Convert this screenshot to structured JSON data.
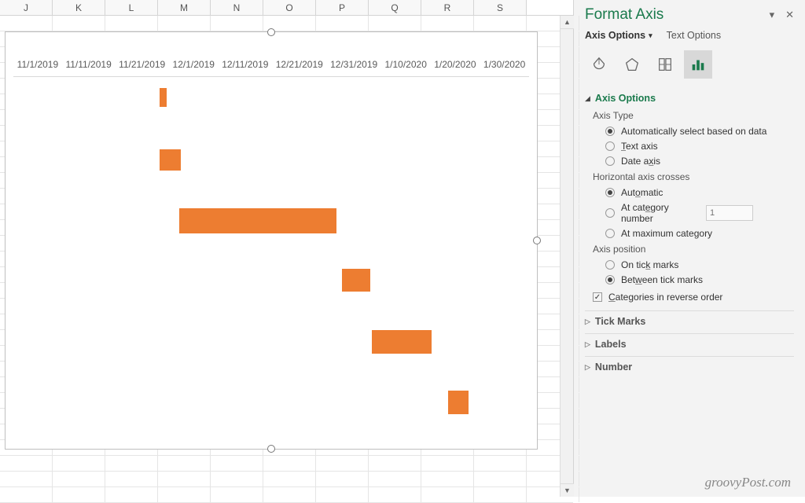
{
  "columns": [
    "J",
    "K",
    "L",
    "M",
    "N",
    "O",
    "P",
    "Q",
    "R",
    "S"
  ],
  "chart_data": {
    "type": "bar",
    "orientation": "horizontal",
    "x_axis_labels": [
      "11/1/2019",
      "11/11/2019",
      "11/21/2019",
      "12/1/2019",
      "12/11/2019",
      "12/21/2019",
      "12/31/2019",
      "1/10/2020",
      "1/20/2020",
      "1/30/2020"
    ],
    "series": [
      {
        "start": "11/21/2019",
        "duration_days": 2
      },
      {
        "start": "11/25/2019",
        "duration_days": 5
      },
      {
        "start": "12/1/2019",
        "duration_days": 30
      },
      {
        "start": "12/31/2019",
        "duration_days": 5
      },
      {
        "start": "1/5/2020",
        "duration_days": 12
      },
      {
        "start": "1/20/2020",
        "duration_days": 5
      }
    ],
    "bar_color": "#ed7d31"
  },
  "panel": {
    "title": "Format Axis",
    "tabs": {
      "axis_options": "Axis Options",
      "text_options": "Text Options"
    },
    "section_axis_options": "Axis Options",
    "axis_type": {
      "label": "Axis Type",
      "auto": "Automatically select based on data",
      "text": "Text axis",
      "date": "Date axis"
    },
    "horiz_crosses": {
      "label": "Horizontal axis crosses",
      "auto": "Automatic",
      "at_cat": "At category number",
      "at_cat_value": "1",
      "at_max": "At maximum category"
    },
    "axis_pos": {
      "label": "Axis position",
      "on_tick": "On tick marks",
      "between_tick": "Between tick marks"
    },
    "reverse_order": "Categories in reverse order",
    "section_tick_marks": "Tick Marks",
    "section_labels": "Labels",
    "section_number": "Number"
  },
  "watermark": "groovyPost.com"
}
